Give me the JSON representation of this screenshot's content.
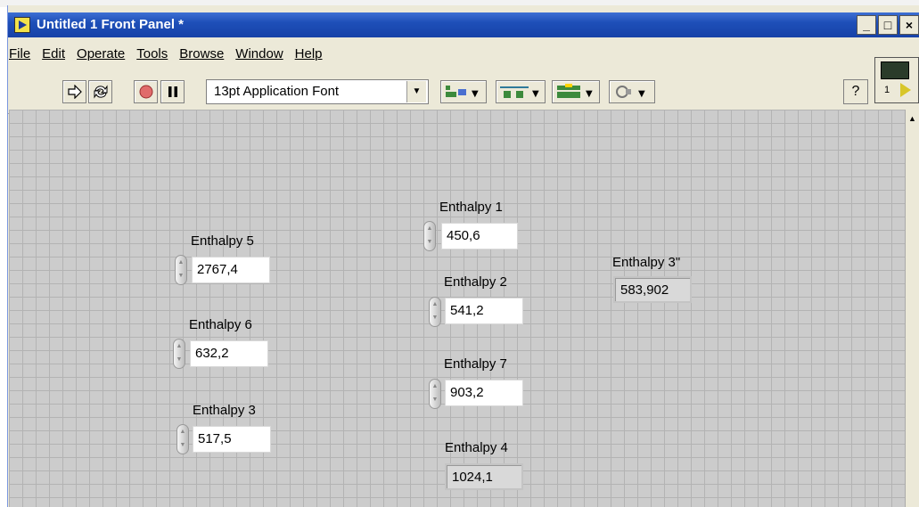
{
  "window": {
    "title": "Untitled 1 Front Panel *",
    "minimize": "_",
    "restore": "□",
    "close": "×"
  },
  "menu": [
    "File",
    "Edit",
    "Operate",
    "Tools",
    "Browse",
    "Window",
    "Help"
  ],
  "toolbar": {
    "font": "13pt Application Font",
    "icons": [
      "run-arrow-icon",
      "run-continuously-icon",
      "abort-icon",
      "pause-icon",
      "align-icon",
      "distribute-icon",
      "resize-icon",
      "reorder-icon"
    ],
    "help": "?",
    "vi_icon_number": "1"
  },
  "controls": [
    {
      "label": "Enthalpy 1",
      "value": "450,6"
    },
    {
      "label": "Enthalpy 2",
      "value": "541,2"
    },
    {
      "label": "Enthalpy 7",
      "value": "903,2"
    },
    {
      "label": "Enthalpy 5",
      "value": "2767,4"
    },
    {
      "label": "Enthalpy 6",
      "value": "632,2"
    },
    {
      "label": "Enthalpy 3",
      "value": "517,5"
    }
  ],
  "indicators": [
    {
      "label": "Enthalpy 3\"",
      "value": "583,902"
    },
    {
      "label": "Enthalpy 4",
      "value": "1024,1"
    }
  ]
}
